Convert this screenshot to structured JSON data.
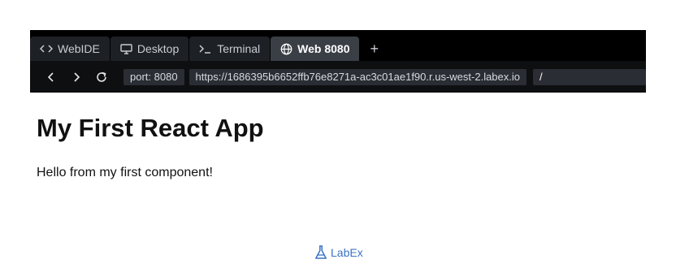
{
  "tabs": [
    {
      "label": "WebIDE",
      "icon": "code-icon"
    },
    {
      "label": "Desktop",
      "icon": "monitor-icon"
    },
    {
      "label": "Terminal",
      "icon": "terminal-icon"
    },
    {
      "label": "Web 8080",
      "icon": "globe-icon",
      "active": true
    }
  ],
  "add_tab_label": "+",
  "nav": {
    "back": "‹",
    "forward": "›",
    "port": "port: 8080",
    "url": "https://1686395b6652ffb76e8271a-ac3c01ae1f90.r.us-west-2.labex.io",
    "path": "/"
  },
  "page": {
    "heading": "My First React App",
    "message": "Hello from my first component!"
  },
  "brand": {
    "label": "LabEx",
    "icon": "flask-icon"
  },
  "colors": {
    "tab_active": "#3a3f46",
    "frame": "#000000",
    "brand": "#3b73c4"
  }
}
